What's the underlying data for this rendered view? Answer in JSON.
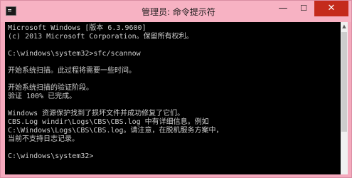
{
  "window": {
    "title": "管理员: 命令提示符",
    "controls": {
      "minimize": "—",
      "maximize": "☐",
      "close": "✕"
    },
    "icon": "cmd-icon"
  },
  "console": {
    "lines": [
      "Microsoft Windows [版本 6.3.9600]",
      "(c) 2013 Microsoft Corporation。保留所有权利。",
      "",
      "C:\\windows\\system32>sfc/scannow",
      "",
      "开始系统扫描。此过程将需要一些时间。",
      "",
      "开始系统扫描的验证阶段。",
      "验证 100% 已完成。",
      "",
      "Windows 资源保护找到了损坏文件并成功修复了它们。",
      "CBS.Log windir\\Logs\\CBS\\CBS.log 中有详细信息。例如",
      "C:\\Windows\\Logs\\CBS\\CBS.log。请注意，在脱机服务方案中，",
      "当前不支持日志记录。",
      "",
      "C:\\windows\\system32>"
    ]
  },
  "scrollbar": {
    "up_arrow": "▲"
  }
}
